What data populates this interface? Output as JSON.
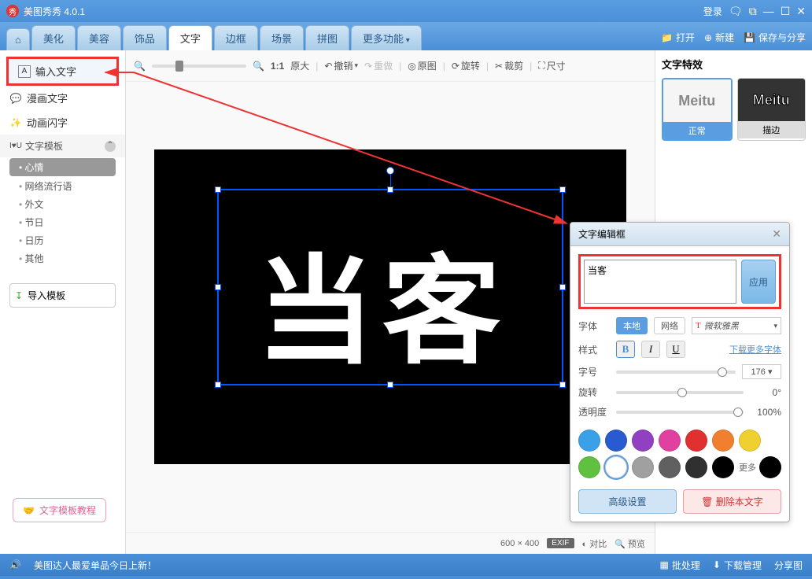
{
  "title": "美图秀秀 4.0.1",
  "titlebar": {
    "login": "登录"
  },
  "tabs": {
    "beautify": "美化",
    "face": "美容",
    "accessory": "饰品",
    "text": "文字",
    "border": "边框",
    "scene": "场景",
    "puzzle": "拼图",
    "more": "更多功能"
  },
  "file_buttons": {
    "open": "打开",
    "new": "新建",
    "save": "保存与分享"
  },
  "sidebar": {
    "input_text": "输入文字",
    "comic_text": "漫画文字",
    "anim_text": "动画闪字",
    "template_header": "文字模板",
    "items": [
      "心情",
      "网络流行语",
      "外文",
      "节日",
      "日历",
      "其他"
    ],
    "import": "导入模板"
  },
  "toolbar": {
    "ratio": "1:1",
    "original_size": "原大",
    "undo": "撤销",
    "redo": "重做",
    "orig": "原图",
    "rotate": "旋转",
    "crop": "裁剪",
    "dimension": "尺寸"
  },
  "right_panel": {
    "title": "文字特效",
    "preview": "Meitu",
    "normal": "正常",
    "outline": "描边"
  },
  "canvas": {
    "text": "当客",
    "dim": "600 × 400"
  },
  "footer": {
    "exif": "EXIF",
    "compare": "对比",
    "preview": "预览"
  },
  "edit_panel": {
    "title": "文字编辑框",
    "input": "当客",
    "apply": "应用",
    "font_label": "字体",
    "local": "本地",
    "network": "网络",
    "font_name": "微软雅黑",
    "style_label": "样式",
    "download_fonts": "下载更多字体",
    "size_label": "字号",
    "size_value": "176 ",
    "rotate_label": "旋转",
    "rotate_value": "0°",
    "opacity_label": "透明度",
    "opacity_value": "100%",
    "more_colors": "更多",
    "advanced": "高级设置",
    "delete": "删除本文字"
  },
  "colors": [
    "#3aa0e8",
    "#2a5ad0",
    "#9040c0",
    "#e040a0",
    "#e03030",
    "#f08030",
    "#f0d030",
    "#60c040",
    "#ffffff",
    "#a0a0a0",
    "#606060",
    "#303030",
    "#000000"
  ],
  "tutorial": "文字模板教程",
  "statusbar": {
    "news": "美图达人最爱单品今日上新！",
    "batch": "批处理",
    "download": "下载管理",
    "share": "分享图"
  }
}
